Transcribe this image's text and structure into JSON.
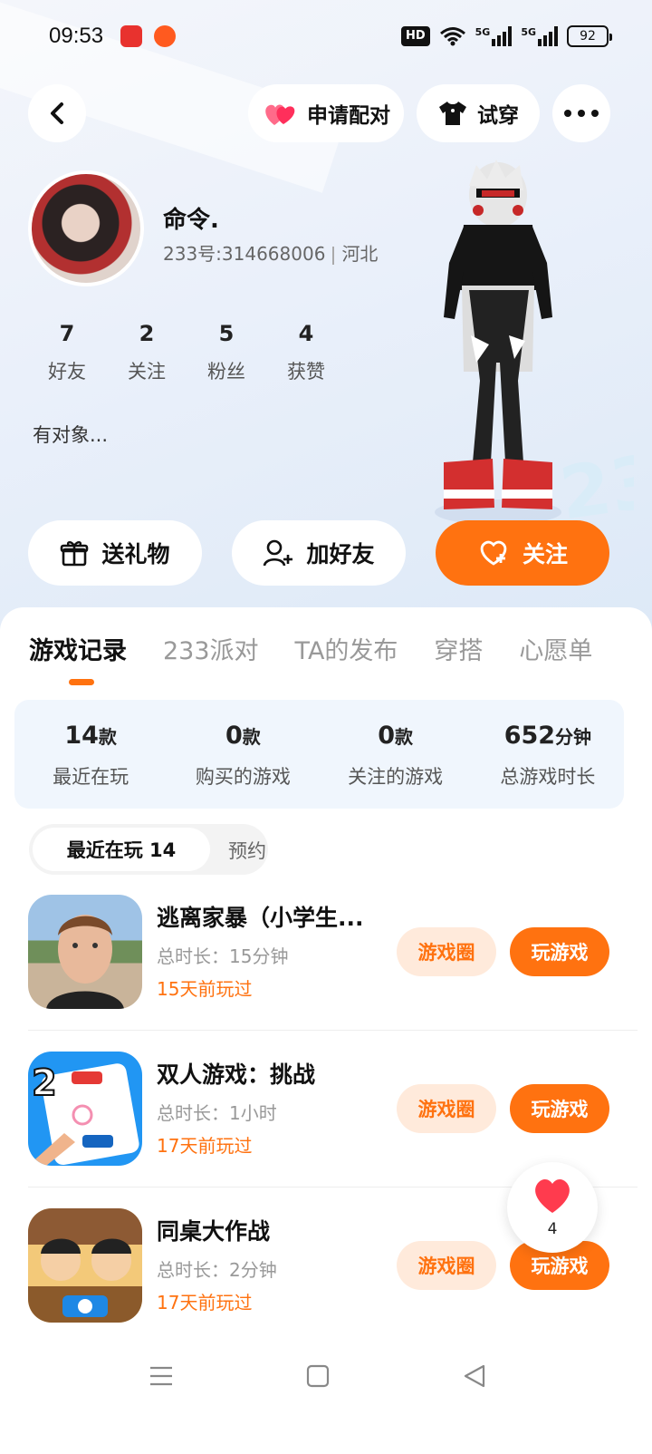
{
  "status_bar": {
    "time": "09:53",
    "hd": "HD",
    "net1": "5G",
    "net2": "5G",
    "battery": "92"
  },
  "header": {
    "pair_label": "申请配对",
    "try_on_label": "试穿"
  },
  "profile": {
    "name": "命令.",
    "uid": "233号:314668006",
    "region": "河北",
    "bio": "有对象..."
  },
  "stats": [
    {
      "value": "7",
      "label": "好友"
    },
    {
      "value": "2",
      "label": "关注"
    },
    {
      "value": "5",
      "label": "粉丝"
    },
    {
      "value": "4",
      "label": "获赞"
    }
  ],
  "actions": {
    "gift_label": "送礼物",
    "add_friend_label": "加好友",
    "follow_label": "关注"
  },
  "tabs": [
    "游戏记录",
    "233派对",
    "TA的发布",
    "穿搭",
    "心愿单"
  ],
  "summary": [
    {
      "value": "14",
      "unit": "款",
      "label": "最近在玩"
    },
    {
      "value": "0",
      "unit": "款",
      "label": "购买的游戏"
    },
    {
      "value": "0",
      "unit": "款",
      "label": "关注的游戏"
    },
    {
      "value": "652",
      "unit": "分钟",
      "label": "总游戏时长"
    }
  ],
  "subtabs": {
    "recent": "最近在玩 14",
    "reserve": "预约"
  },
  "games": [
    {
      "title": "逃离家暴（小学生...",
      "duration": "总时长：15分钟",
      "last_played": "15天前玩过",
      "circle_label": "游戏圈",
      "play_label": "玩游戏"
    },
    {
      "title": "双人游戏：挑战",
      "duration": "总时长：1小时",
      "last_played": "17天前玩过",
      "circle_label": "游戏圈",
      "play_label": "玩游戏"
    },
    {
      "title": "同桌大作战",
      "duration": "总时长：2分钟",
      "last_played": "17天前玩过",
      "circle_label": "游戏圈",
      "play_label": "玩游戏"
    }
  ],
  "floating_like": {
    "count": "4"
  },
  "colors": {
    "accent": "#ff7210",
    "accent_light": "#ffeadb",
    "summary_bg": "#f0f6fd"
  }
}
